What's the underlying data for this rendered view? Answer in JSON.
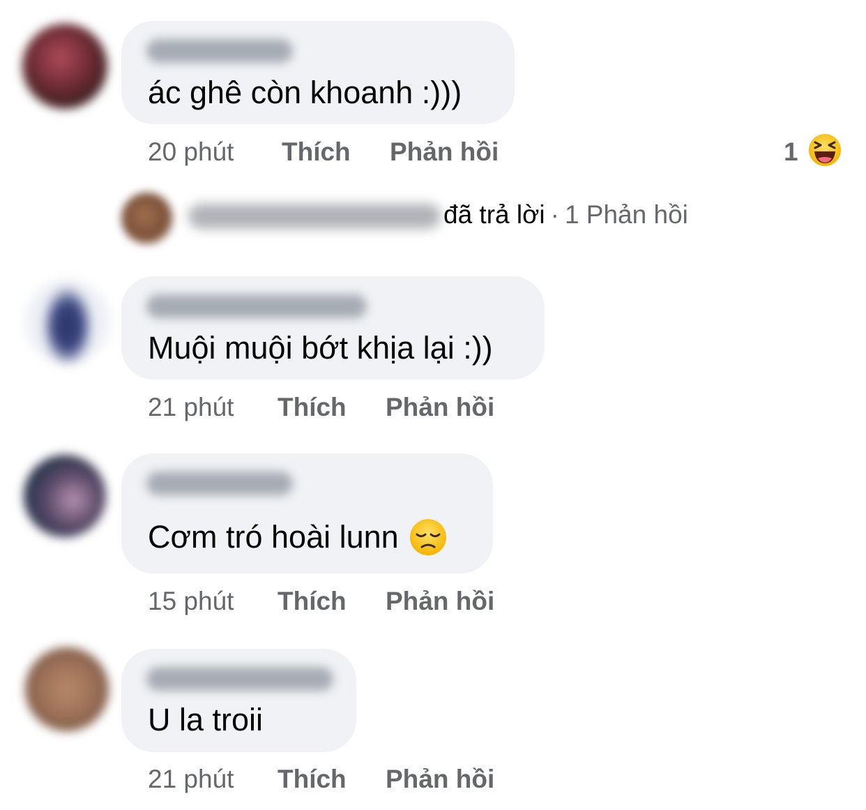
{
  "comments": [
    {
      "text": "ác ghê còn khoanh :)))",
      "time": "20 phút",
      "like": "Thích",
      "reply": "Phản hồi",
      "reaction_count": "1",
      "reaction_icon": "laughing-emoji-icon"
    },
    {
      "text": "Muội muội bớt khịa lại :))",
      "time": "21 phút",
      "like": "Thích",
      "reply": "Phản hồi"
    },
    {
      "text": "Cơm tró hoài lunn",
      "emoji": "disappointed-face-icon",
      "time": "15 phút",
      "like": "Thích",
      "reply": "Phản hồi"
    },
    {
      "text": "U la troii",
      "time": "21 phút",
      "like": "Thích",
      "reply": "Phản hồi"
    }
  ],
  "replies_summary": {
    "replied_label": "đã trả lời",
    "separator": "·",
    "count_label": "1 Phản hồi"
  },
  "colors": {
    "bubble": "#f0f2f5",
    "secondary_text": "#65676b",
    "primary_text": "#050505"
  }
}
